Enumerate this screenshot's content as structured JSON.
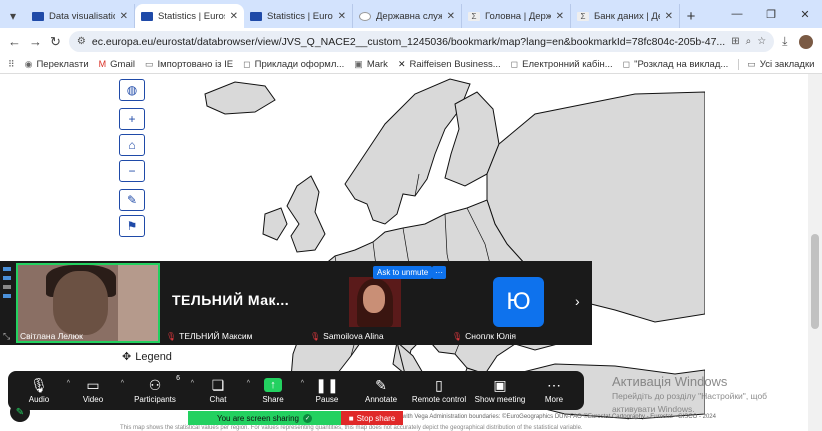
{
  "tabs": [
    {
      "label": "Data visualisations",
      "favicon": "eu-flag",
      "active": false
    },
    {
      "label": "Statistics | Eurostat",
      "favicon": "eu-flag",
      "active": true
    },
    {
      "label": "Statistics | Eurostat",
      "favicon": "eu-flag",
      "active": false
    },
    {
      "label": "Державна служба",
      "favicon": "globe",
      "active": false
    },
    {
      "label": "Головна | Держав",
      "favicon": "sigma",
      "active": false
    },
    {
      "label": "Банк даних | Дер",
      "favicon": "sigma",
      "active": false
    }
  ],
  "address": {
    "url": "ec.europa.eu/eurostat/databrowser/view/JVS_Q_NACE2__custom_1245036/bookmark/map?lang=en&bookmarkId=78fc804c-205b-47..."
  },
  "bookmarks": {
    "items": [
      "Переклasти",
      "Gmail",
      "Імпортовано із IE",
      "Приклади оформл...",
      "Mark",
      "Raiffeisen Business...",
      "Електронний кабін...",
      "\"Розклад на виклад..."
    ],
    "all_label": "Усі закладки"
  },
  "map": {
    "legend_label": "Legend",
    "credits": "with Vega Administration boundaries: ©EuroGeographics DUN-FAO ©Eurostat Cartography - Eurostat - GISCO - 2024",
    "footnote": "This map shows the statistical values per region. For values representing quantities, this map does not accurately depict the geographical distribution of the statistical variable."
  },
  "zoom": {
    "self_name": "Світлана Лелюк",
    "big_name": "ТЕЛЬНИЙ  Мак...",
    "participants": [
      {
        "name": "ТЕЛЬНИЙ Максим",
        "muted": true
      },
      {
        "name": "Samoilova Alina",
        "muted": true
      },
      {
        "name": "Сноплк Юлія",
        "muted": true
      }
    ],
    "avatar_letter": "Ю",
    "ask_unmute": "Ask to unmute",
    "more_dots": "···",
    "participants_count": "6",
    "toolbar": [
      {
        "label": "Audio",
        "icon": "mic-icon"
      },
      {
        "label": "Video",
        "icon": "camera-icon"
      },
      {
        "label": "Participants",
        "icon": "people-icon"
      },
      {
        "label": "Chat",
        "icon": "chat-icon"
      },
      {
        "label": "Share",
        "icon": "share-icon"
      },
      {
        "label": "Pause",
        "icon": "pause-icon"
      },
      {
        "label": "Annotate",
        "icon": "pencil-icon"
      },
      {
        "label": "Remote control",
        "icon": "mouse-icon"
      },
      {
        "label": "Show meeting",
        "icon": "meeting-icon"
      },
      {
        "label": "More",
        "icon": "more-icon"
      }
    ],
    "sharing_label": "You are screen sharing",
    "stop_label": "Stop share"
  },
  "windows": {
    "title": "Активація Windows",
    "line1": "Перейдіть до розділу \"Настройки\", щоб",
    "line2": "активувати Windows."
  }
}
